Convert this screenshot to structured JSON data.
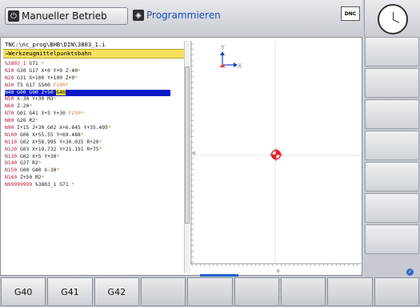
{
  "header": {
    "mode_manual_label": "Manueller Betrieb",
    "mode_program_label": "Programmieren",
    "dnc_label": "DNC"
  },
  "program": {
    "path": "TNC:\\nc_prog\\BHB\\DIN\\3803_1.i",
    "function": "→Werkzeugmittelpunktsbahn",
    "lines": [
      {
        "nr": "%3803_1",
        "body": " G71 ",
        "tail": "*",
        "selected": false
      },
      {
        "nr": "N10",
        "body": " G30 G17 X+0 Y+0 Z-40",
        "tail": "*",
        "selected": false
      },
      {
        "nr": "N20",
        "body": " G31 X+100 Y+100 Z+0",
        "tail": "*",
        "selected": false
      },
      {
        "nr": "N30",
        "body": " T5 G17 S500 ",
        "tail": "F100*",
        "selected": false
      },
      {
        "nr": "N40",
        "body": " G00 G90 Z+50 ",
        "hl": "G40",
        "tail": "",
        "selected": true
      },
      {
        "nr": "N50",
        "body": " X-30 Y+30 M3",
        "tail": "*",
        "selected": false
      },
      {
        "nr": "N60",
        "body": " Z-20",
        "tail": "*",
        "selected": false
      },
      {
        "nr": "N70",
        "body": " G01 G41 X+5 Y+30 ",
        "tail": "F250*",
        "selected": false
      },
      {
        "nr": "N80",
        "body": " G26 R2",
        "tail": "*",
        "selected": false
      },
      {
        "nr": "N90",
        "body": " I+15 J+30 G02 X+6.645 Y+35.495",
        "tail": "*",
        "selected": false
      },
      {
        "nr": "N100",
        "body": " G06 X+55.55 Y+69.488",
        "tail": "*",
        "selected": false
      },
      {
        "nr": "N110",
        "body": " G02 X+58.995 Y+30.025 R+20",
        "tail": "*",
        "selected": false
      },
      {
        "nr": "N120",
        "body": " G03 X+19.732 Y+21.191 R+75",
        "tail": "*",
        "selected": false
      },
      {
        "nr": "N130",
        "body": " G02 X+5 Y+30",
        "tail": "*",
        "selected": false
      },
      {
        "nr": "N140",
        "body": " G27 R2",
        "tail": "*",
        "selected": false
      },
      {
        "nr": "N150",
        "body": " G00 G40 X-30",
        "tail": "*",
        "selected": false
      },
      {
        "nr": "N160",
        "body": " Z+50 M2",
        "tail": "*",
        "selected": false
      },
      {
        "nr": "N99999999",
        "body": " %3803_1 G71 ",
        "tail": "*",
        "selected": false
      }
    ]
  },
  "graphic": {
    "axis_y": "Y",
    "axis_x": "X",
    "ruler_zero_v": "0",
    "ruler_zero_h": "0"
  },
  "softkeys": [
    "G40",
    "G41",
    "G42",
    "",
    "",
    "",
    "",
    "",
    ""
  ],
  "colors": {
    "selection": "#0a18c8",
    "block_number": "#c0162a",
    "target": "#e0202a"
  }
}
